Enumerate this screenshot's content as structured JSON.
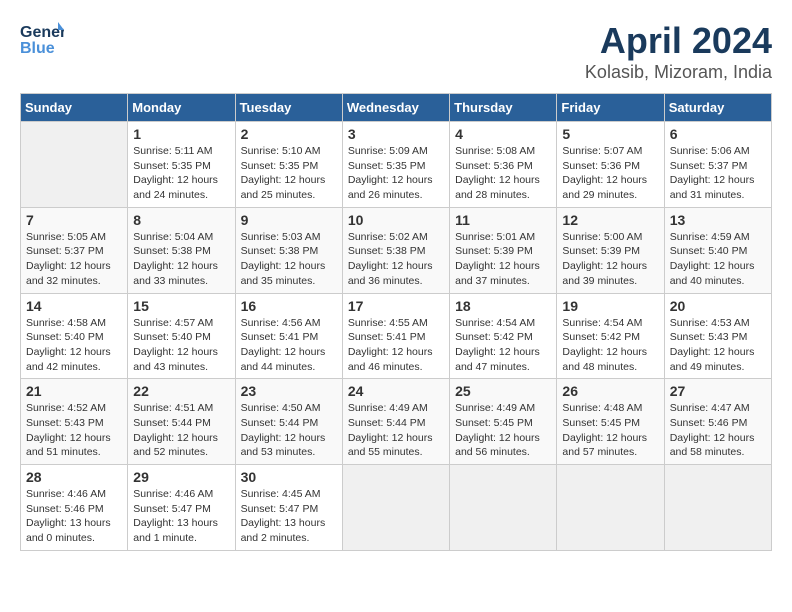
{
  "header": {
    "logo_general": "General",
    "logo_blue": "Blue",
    "month": "April 2024",
    "location": "Kolasib, Mizoram, India"
  },
  "weekdays": [
    "Sunday",
    "Monday",
    "Tuesday",
    "Wednesday",
    "Thursday",
    "Friday",
    "Saturday"
  ],
  "weeks": [
    [
      {
        "day": "",
        "text": ""
      },
      {
        "day": "1",
        "text": "Sunrise: 5:11 AM\nSunset: 5:35 PM\nDaylight: 12 hours\nand 24 minutes."
      },
      {
        "day": "2",
        "text": "Sunrise: 5:10 AM\nSunset: 5:35 PM\nDaylight: 12 hours\nand 25 minutes."
      },
      {
        "day": "3",
        "text": "Sunrise: 5:09 AM\nSunset: 5:35 PM\nDaylight: 12 hours\nand 26 minutes."
      },
      {
        "day": "4",
        "text": "Sunrise: 5:08 AM\nSunset: 5:36 PM\nDaylight: 12 hours\nand 28 minutes."
      },
      {
        "day": "5",
        "text": "Sunrise: 5:07 AM\nSunset: 5:36 PM\nDaylight: 12 hours\nand 29 minutes."
      },
      {
        "day": "6",
        "text": "Sunrise: 5:06 AM\nSunset: 5:37 PM\nDaylight: 12 hours\nand 31 minutes."
      }
    ],
    [
      {
        "day": "7",
        "text": "Sunrise: 5:05 AM\nSunset: 5:37 PM\nDaylight: 12 hours\nand 32 minutes."
      },
      {
        "day": "8",
        "text": "Sunrise: 5:04 AM\nSunset: 5:38 PM\nDaylight: 12 hours\nand 33 minutes."
      },
      {
        "day": "9",
        "text": "Sunrise: 5:03 AM\nSunset: 5:38 PM\nDaylight: 12 hours\nand 35 minutes."
      },
      {
        "day": "10",
        "text": "Sunrise: 5:02 AM\nSunset: 5:38 PM\nDaylight: 12 hours\nand 36 minutes."
      },
      {
        "day": "11",
        "text": "Sunrise: 5:01 AM\nSunset: 5:39 PM\nDaylight: 12 hours\nand 37 minutes."
      },
      {
        "day": "12",
        "text": "Sunrise: 5:00 AM\nSunset: 5:39 PM\nDaylight: 12 hours\nand 39 minutes."
      },
      {
        "day": "13",
        "text": "Sunrise: 4:59 AM\nSunset: 5:40 PM\nDaylight: 12 hours\nand 40 minutes."
      }
    ],
    [
      {
        "day": "14",
        "text": "Sunrise: 4:58 AM\nSunset: 5:40 PM\nDaylight: 12 hours\nand 42 minutes."
      },
      {
        "day": "15",
        "text": "Sunrise: 4:57 AM\nSunset: 5:40 PM\nDaylight: 12 hours\nand 43 minutes."
      },
      {
        "day": "16",
        "text": "Sunrise: 4:56 AM\nSunset: 5:41 PM\nDaylight: 12 hours\nand 44 minutes."
      },
      {
        "day": "17",
        "text": "Sunrise: 4:55 AM\nSunset: 5:41 PM\nDaylight: 12 hours\nand 46 minutes."
      },
      {
        "day": "18",
        "text": "Sunrise: 4:54 AM\nSunset: 5:42 PM\nDaylight: 12 hours\nand 47 minutes."
      },
      {
        "day": "19",
        "text": "Sunrise: 4:54 AM\nSunset: 5:42 PM\nDaylight: 12 hours\nand 48 minutes."
      },
      {
        "day": "20",
        "text": "Sunrise: 4:53 AM\nSunset: 5:43 PM\nDaylight: 12 hours\nand 49 minutes."
      }
    ],
    [
      {
        "day": "21",
        "text": "Sunrise: 4:52 AM\nSunset: 5:43 PM\nDaylight: 12 hours\nand 51 minutes."
      },
      {
        "day": "22",
        "text": "Sunrise: 4:51 AM\nSunset: 5:44 PM\nDaylight: 12 hours\nand 52 minutes."
      },
      {
        "day": "23",
        "text": "Sunrise: 4:50 AM\nSunset: 5:44 PM\nDaylight: 12 hours\nand 53 minutes."
      },
      {
        "day": "24",
        "text": "Sunrise: 4:49 AM\nSunset: 5:44 PM\nDaylight: 12 hours\nand 55 minutes."
      },
      {
        "day": "25",
        "text": "Sunrise: 4:49 AM\nSunset: 5:45 PM\nDaylight: 12 hours\nand 56 minutes."
      },
      {
        "day": "26",
        "text": "Sunrise: 4:48 AM\nSunset: 5:45 PM\nDaylight: 12 hours\nand 57 minutes."
      },
      {
        "day": "27",
        "text": "Sunrise: 4:47 AM\nSunset: 5:46 PM\nDaylight: 12 hours\nand 58 minutes."
      }
    ],
    [
      {
        "day": "28",
        "text": "Sunrise: 4:46 AM\nSunset: 5:46 PM\nDaylight: 13 hours\nand 0 minutes."
      },
      {
        "day": "29",
        "text": "Sunrise: 4:46 AM\nSunset: 5:47 PM\nDaylight: 13 hours\nand 1 minute."
      },
      {
        "day": "30",
        "text": "Sunrise: 4:45 AM\nSunset: 5:47 PM\nDaylight: 13 hours\nand 2 minutes."
      },
      {
        "day": "",
        "text": ""
      },
      {
        "day": "",
        "text": ""
      },
      {
        "day": "",
        "text": ""
      },
      {
        "day": "",
        "text": ""
      }
    ]
  ]
}
